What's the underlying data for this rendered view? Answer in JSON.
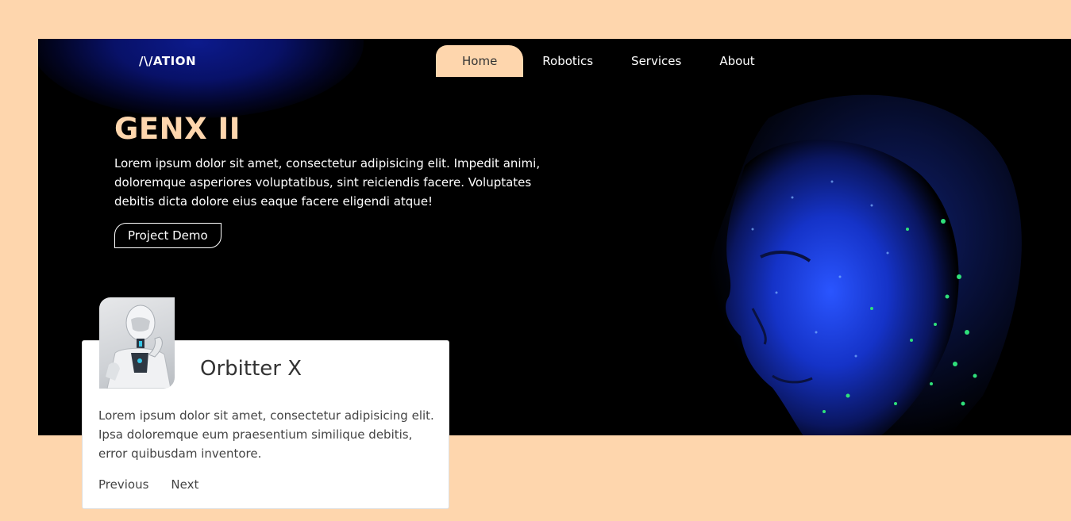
{
  "brand": {
    "logo": "/\\/ATION"
  },
  "nav": {
    "items": [
      {
        "label": "Home"
      },
      {
        "label": "Robotics"
      },
      {
        "label": "Services"
      },
      {
        "label": "About"
      }
    ]
  },
  "hero": {
    "title": "GENX II",
    "description": "Lorem ipsum dolor sit amet, consectetur adipisicing elit. Impedit animi, doloremque asperiores voluptatibus, sint reiciendis facere. Voluptates debitis dicta dolore eius eaque facere eligendi atque!",
    "button_label": "Project Demo"
  },
  "card": {
    "title": "Orbitter X",
    "description": "Lorem ipsum dolor sit amet, consectetur adipisicing elit. Ipsa doloremque eum praesentium similique debitis, error quibusdam inventore.",
    "prev_label": "Previous",
    "next_label": "Next"
  },
  "colors": {
    "page_bg": "#fed6ad",
    "hero_bg": "#000000",
    "accent": "#fed6ad",
    "card_bg": "#ffffff"
  }
}
